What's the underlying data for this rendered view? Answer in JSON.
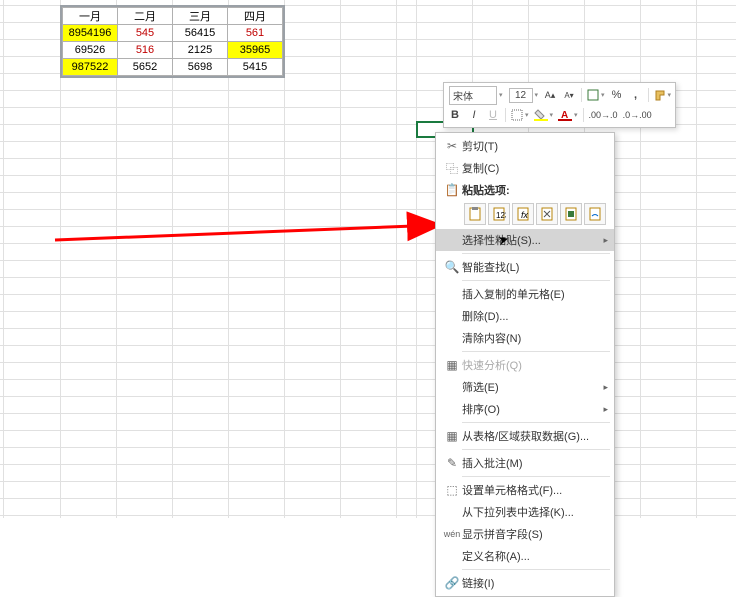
{
  "table": {
    "headers": [
      "一月",
      "二月",
      "三月",
      "四月"
    ],
    "rows": [
      [
        "8954196",
        "545",
        "56415",
        "561"
      ],
      [
        "69526",
        "516",
        "2125",
        "35965"
      ],
      [
        "987522",
        "5652",
        "5698",
        "5415"
      ]
    ]
  },
  "mini_toolbar": {
    "font_name": "宋体",
    "font_size": "12"
  },
  "context_menu": {
    "cut": "剪切(T)",
    "copy": "复制(C)",
    "paste_options_label": "粘贴选项:",
    "paste_special": "选择性粘贴(S)...",
    "smart_lookup": "智能查找(L)",
    "insert_copied_cells": "插入复制的单元格(E)",
    "delete": "删除(D)...",
    "clear": "清除内容(N)",
    "quick_analysis": "快速分析(Q)",
    "filter": "筛选(E)",
    "sort": "排序(O)",
    "get_data_from_range": "从表格/区域获取数据(G)...",
    "insert_comment": "插入批注(M)",
    "format_cells": "设置单元格格式(F)...",
    "pick_from_dropdown": "从下拉列表中选择(K)...",
    "show_pinyin": "显示拼音字段(S)",
    "define_name": "定义名称(A)...",
    "link": "链接(I)"
  }
}
